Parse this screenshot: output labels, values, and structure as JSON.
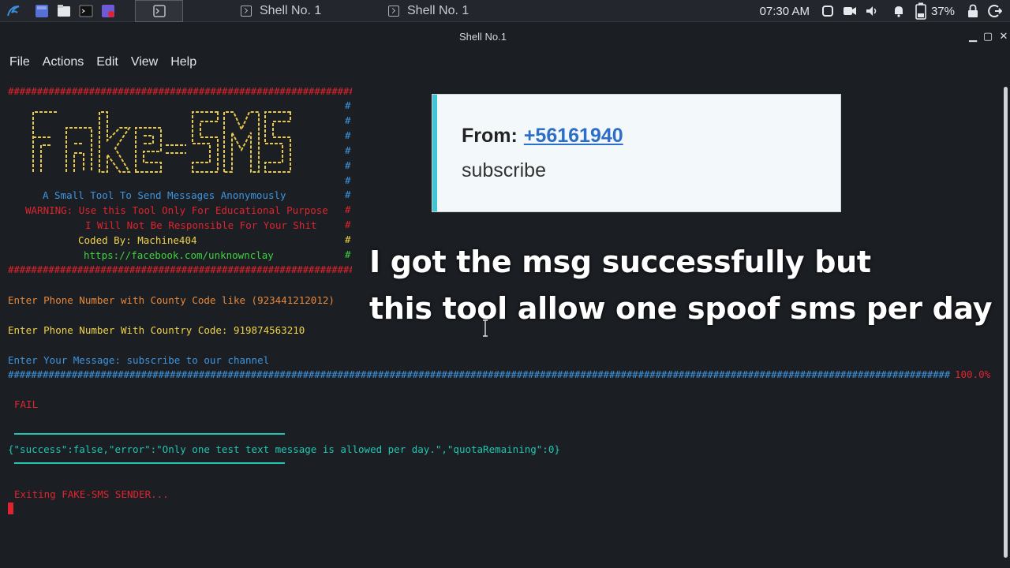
{
  "taskbar": {
    "tasks": [
      {
        "label": "Shell No. 1"
      },
      {
        "label": "Shell No. 1"
      }
    ],
    "time": "07:30 AM",
    "battery": "37%"
  },
  "window": {
    "title": "Shell No.1"
  },
  "menu": [
    "File",
    "Actions",
    "Edit",
    "View",
    "Help"
  ],
  "terminal": {
    "hash_top": "################################################################",
    "hash_mid": "################################################################",
    "ascii_art": [
      " _____  ___  _  _ ____     ____  _   _  ____ ",
      "|  ___|/ _ \\| |/ /| ___|  / ___|| \\ / |/ ___|",
      "| |_  | |_| | ' / |  _|___\\___ \\|  V  |\\___ \\",
      "|  _| |  _  | . \\ | |_|___|___) | |\\/| | ___) |",
      "|_|   |_| |_|_|\\_\\|____|  |____/|_|  |_||____/"
    ],
    "tagline": "A Small Tool To Send Messages Anonymously",
    "warning1": "WARNING: Use this Tool Only For Educational Purpose",
    "warning2": "I Will Not Be Responsible For Your Shit",
    "coded_by": "Coded By: Machine404",
    "link": "https://facebook.com/unknownclay",
    "prompt_hint": "Enter Phone Number with County Code like (923441212012)",
    "prompt_phone": "Enter Phone Number With Country Code: 919874563210",
    "prompt_message": "Enter Your Message: subscribe to our channel",
    "progress_percent": "100.0%",
    "fail": "FAIL",
    "response": "{\"success\":false,\"error\":\"Only one test text message is allowed per day.\",\"quotaRemaining\":0}",
    "exiting": "Exiting FAKE-SMS SENDER..."
  },
  "sms_card": {
    "from_label": "From:",
    "from_number": "+56161940",
    "body": "subscribe"
  },
  "caption": {
    "line1": "I got the msg successfully but",
    "line2": "this tool allow one spoof sms per day"
  },
  "colors": {
    "accent_red": "#e0242d",
    "accent_blue": "#3f95de",
    "accent_cyan": "#1fc7b3",
    "accent_green": "#3fd340"
  }
}
